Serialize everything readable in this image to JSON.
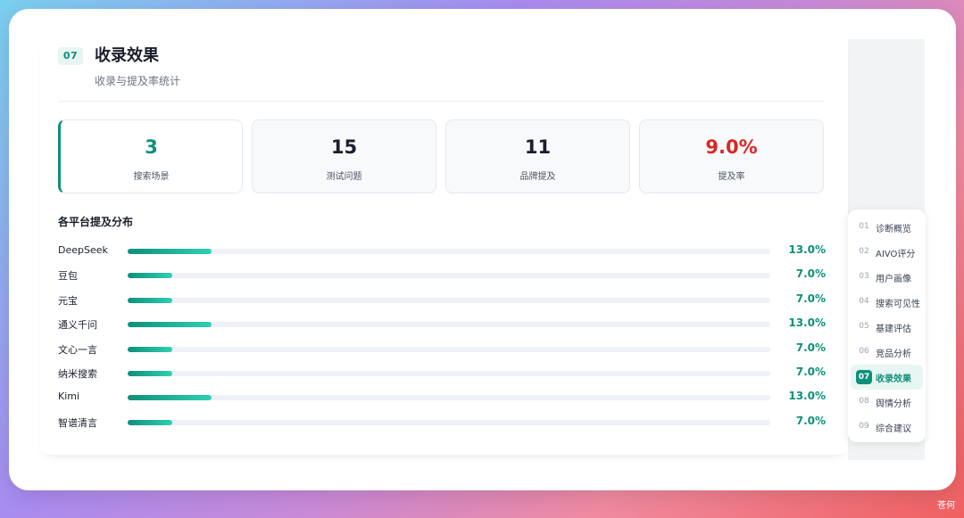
{
  "section": {
    "number": "07",
    "title": "收录效果",
    "subtitle": "收录与提及率统计"
  },
  "stats": [
    {
      "value": "3",
      "label": "搜索场景",
      "color": "#0f8f7a"
    },
    {
      "value": "15",
      "label": "测试问题",
      "color": "#1a1f2b"
    },
    {
      "value": "11",
      "label": "品牌提及",
      "color": "#1a1f2b"
    },
    {
      "value": "9.0%",
      "label": "提及率",
      "color": "#dc2626"
    }
  ],
  "distribution": {
    "title": "各平台提及分布"
  },
  "chart_data": {
    "type": "bar",
    "categories": [
      "DeepSeek",
      "豆包",
      "元宝",
      "通义千问",
      "文心一言",
      "纳米搜索",
      "Kimi",
      "智谱清言"
    ],
    "values": [
      13.0,
      7.0,
      7.0,
      13.0,
      7.0,
      7.0,
      13.0,
      7.0
    ],
    "value_labels": [
      "13.0%",
      "7.0%",
      "7.0%",
      "13.0%",
      "7.0%",
      "7.0%",
      "13.0%",
      "7.0%"
    ],
    "title": "各平台提及分布",
    "xlim": [
      0,
      100
    ],
    "orientation": "horizontal"
  },
  "nav": {
    "items": [
      {
        "num": "01",
        "label": "诊断概览"
      },
      {
        "num": "02",
        "label": "AIVO评分"
      },
      {
        "num": "03",
        "label": "用户画像"
      },
      {
        "num": "04",
        "label": "搜索可见性"
      },
      {
        "num": "05",
        "label": "基建评估"
      },
      {
        "num": "06",
        "label": "竞品分析"
      },
      {
        "num": "07",
        "label": "收录效果"
      },
      {
        "num": "08",
        "label": "舆情分析"
      },
      {
        "num": "09",
        "label": "综合建议"
      }
    ],
    "active_index": 6
  },
  "watermark": "苍何",
  "colors": {
    "accent": "#0f8f7a",
    "danger": "#dc2626"
  }
}
